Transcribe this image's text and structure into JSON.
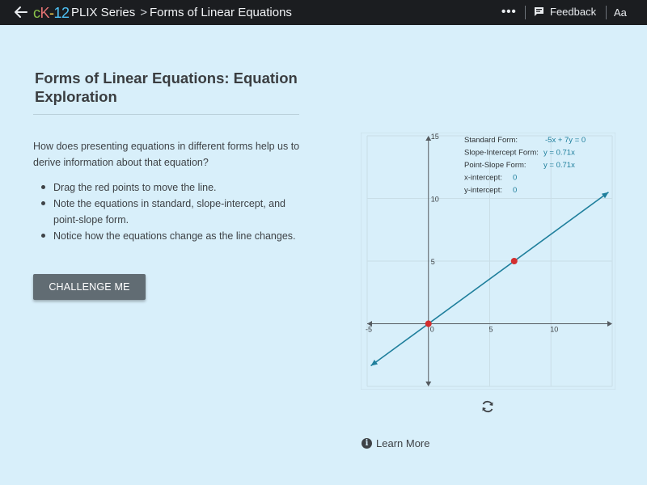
{
  "topbar": {
    "logo": {
      "c": "c",
      "k": "K",
      "dash": "-",
      "num": "12"
    },
    "breadcrumb": {
      "series": "PLIX Series",
      "separator": ">",
      "page": "Forms of Linear Equations"
    },
    "more_label": "•••",
    "feedback_label": "Feedback",
    "font_size_label": "Aa"
  },
  "main": {
    "title": "Forms of Linear Equations: Equation Exploration",
    "question": "How does presenting equations in different forms help us to derive information about that equation?",
    "bullets": [
      "Drag the red points to move the line.",
      "Note the equations in standard, slope-intercept, and point-slope form.",
      "Notice how the equations change as the line changes."
    ],
    "challenge_label": "CHALLENGE ME",
    "learn_more_label": "Learn More",
    "info_glyph": "i"
  },
  "graph": {
    "x_range": [
      -5,
      15
    ],
    "y_range": [
      -5,
      15
    ],
    "x_ticks": [
      "-5",
      "0",
      "5",
      "10"
    ],
    "y_ticks": [
      "15",
      "10",
      "5"
    ],
    "points": [
      {
        "x": 0,
        "y": 0
      },
      {
        "x": 7,
        "y": 5
      }
    ],
    "line_color": "#1f7f9c",
    "point_color": "#d32f2f",
    "info": [
      {
        "label": "Standard Form:",
        "value": "-5x + 7y = 0"
      },
      {
        "label": "Slope-Intercept Form:",
        "value": "y = 0.71x"
      },
      {
        "label": "Point-Slope Form:",
        "value": "y = 0.71x"
      },
      {
        "label": "x-intercept:",
        "value": "0"
      },
      {
        "label": "y-intercept:",
        "value": "0"
      }
    ]
  },
  "colors": {
    "background": "#d8effa",
    "topbar": "#1b1d20",
    "button": "#616c73",
    "value_text": "#1f7f9c"
  },
  "icons": {
    "back": "arrow-left-icon",
    "feedback": "feedback-icon",
    "reset": "refresh-icon",
    "info": "info-icon"
  }
}
